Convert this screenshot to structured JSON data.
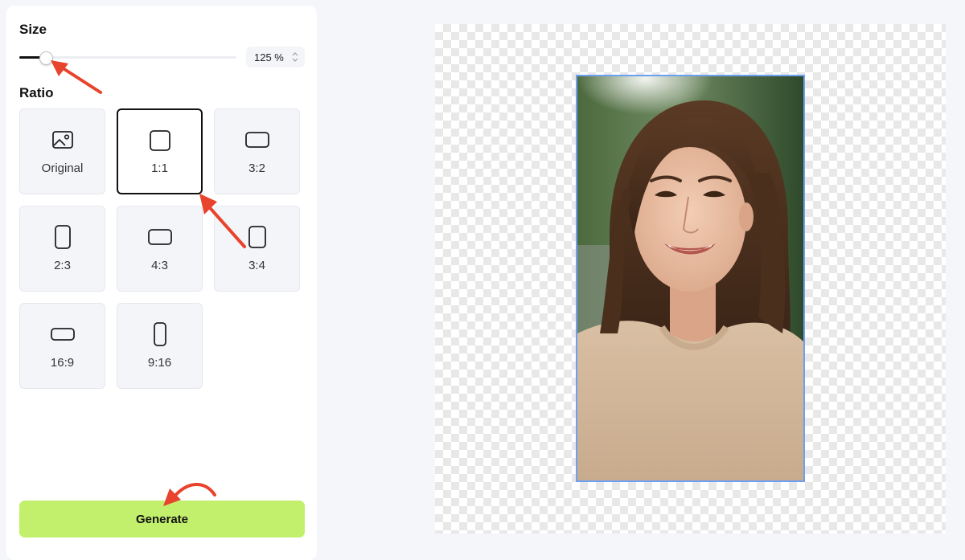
{
  "size": {
    "title": "Size",
    "value_label": "125 %",
    "value": 125
  },
  "ratio": {
    "title": "Ratio",
    "selected": "1:1",
    "options": [
      {
        "label": "Original",
        "icon": "image-icon"
      },
      {
        "label": "1:1",
        "icon": "square-icon"
      },
      {
        "label": "3:2",
        "icon": "landscape-rect-icon"
      },
      {
        "label": "2:3",
        "icon": "portrait-rect-icon"
      },
      {
        "label": "4:3",
        "icon": "landscape-rect-icon"
      },
      {
        "label": "3:4",
        "icon": "portrait-rect-icon"
      },
      {
        "label": "16:9",
        "icon": "wide-rect-icon"
      },
      {
        "label": "9:16",
        "icon": "tall-rect-icon"
      }
    ]
  },
  "generate": {
    "label": "Generate",
    "color": "#c2f06c"
  },
  "preview": {
    "selection_color": "#6ea0f2"
  },
  "annotations": {
    "arrow_color": "#e8432c"
  }
}
